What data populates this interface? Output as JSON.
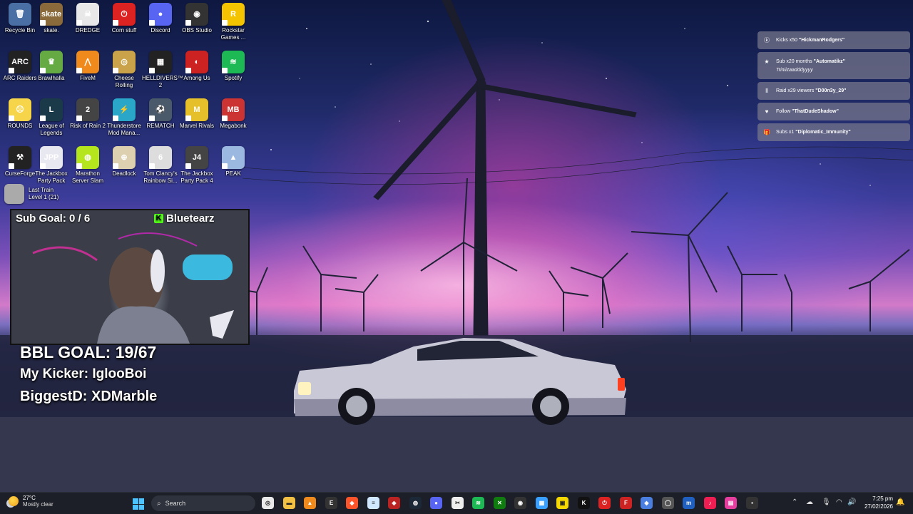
{
  "desktop_icons": [
    {
      "label": "Recycle Bin",
      "color": "#4a6fa5",
      "glyph": "🗑"
    },
    {
      "label": "skate.",
      "color": "#8a6a3a",
      "glyph": "skate"
    },
    {
      "label": "DREDGE",
      "color": "#e8e8e8",
      "glyph": "☠"
    },
    {
      "label": "Corn stuff",
      "color": "#d22",
      "glyph": "⏻"
    },
    {
      "label": "Discord",
      "color": "#5865f2",
      "glyph": "●"
    },
    {
      "label": "OBS Studio",
      "color": "#333",
      "glyph": "◉"
    },
    {
      "label": "Rockstar Games ...",
      "color": "#f5c400",
      "glyph": "R"
    },
    {
      "label": "ARC Raiders",
      "color": "#222",
      "glyph": "ARC"
    },
    {
      "label": "Brawlhalla",
      "color": "#6a4",
      "glyph": "♛"
    },
    {
      "label": "FiveM",
      "color": "#f08a1c",
      "glyph": "⋀"
    },
    {
      "label": "Cheese Rolling",
      "color": "#c9a24a",
      "glyph": "◎"
    },
    {
      "label": "HELLDIVERS™ 2",
      "color": "#222",
      "glyph": "▦"
    },
    {
      "label": "Among Us",
      "color": "#c22",
      "glyph": "◐"
    },
    {
      "label": "Spotify",
      "color": "#1db954",
      "glyph": "≋"
    },
    {
      "label": "ROUNDS",
      "color": "#f6d54a",
      "glyph": "☹"
    },
    {
      "label": "League of Legends",
      "color": "#1a3a4a",
      "glyph": "L"
    },
    {
      "label": "Risk of Rain 2",
      "color": "#444",
      "glyph": "2"
    },
    {
      "label": "Thunderstore Mod Mana...",
      "color": "#2aa6c9",
      "glyph": "⚡"
    },
    {
      "label": "REMATCH",
      "color": "#4a5a6a",
      "glyph": "⚽"
    },
    {
      "label": "Marvel Rivals",
      "color": "#e5c02a",
      "glyph": "M"
    },
    {
      "label": "Megabonk",
      "color": "#c33",
      "glyph": "MB"
    },
    {
      "label": "CurseForge",
      "color": "#222",
      "glyph": "⚒"
    },
    {
      "label": "The Jackbox Party Pack",
      "color": "#e8e8f0",
      "glyph": "JPP"
    },
    {
      "label": "Marathon Server Slam",
      "color": "#b5e61d",
      "glyph": "◍"
    },
    {
      "label": "Deadlock",
      "color": "#ddd0b0",
      "glyph": "⊕"
    },
    {
      "label": "Tom Clancy's Rainbow Si...",
      "color": "#ddd",
      "glyph": "6"
    },
    {
      "label": "The Jackbox Party Pack 4",
      "color": "#444",
      "glyph": "J4"
    },
    {
      "label": "PEAK",
      "color": "#9ab8e0",
      "glyph": "▲"
    },
    {
      "label": "Last Train",
      "color": "#aaa",
      "glyph": ""
    },
    {
      "label": "Level 1 (21)",
      "color": "#aaa",
      "glyph": ""
    }
  ],
  "stream": {
    "sub_goal": "Sub Goal:  0 / 6",
    "kick_logo": "K",
    "channel": "Bluetearz",
    "bbl_goal": "BBL GOAL: 19/67",
    "my_kicker": "My Kicker: IglooBoi",
    "biggest_d": "BiggestD: XDMarble"
  },
  "alerts": [
    {
      "icon": "ⓚ",
      "text": "Kicks x50 ",
      "who": "\"HickmanRodgers\"",
      "msg": ""
    },
    {
      "icon": "★",
      "text": "Sub x20 months ",
      "who": "\"Automatikz\"",
      "msg": "Triniizaadddyyyy"
    },
    {
      "icon": "⦀",
      "text": "Raid x29 viewers ",
      "who": "\"D00n3y_29\"",
      "msg": ""
    },
    {
      "icon": "♥",
      "text": "Follow ",
      "who": "\"ThatDudeShadow\"",
      "msg": ""
    },
    {
      "icon": "🎁",
      "text": "Subs x1 ",
      "who": "\"Diplomatic_Immunity\"",
      "msg": ""
    }
  ],
  "taskbar": {
    "weather_temp": "27°C",
    "weather_cond": "Mostly clear",
    "search_placeholder": "Search",
    "apps": [
      {
        "name": "chrome",
        "color": "#e9e9e9",
        "glyph": "◎"
      },
      {
        "name": "file-explorer",
        "color": "#f2c043",
        "glyph": "▬"
      },
      {
        "name": "vlc",
        "color": "#f08a1c",
        "glyph": "▲"
      },
      {
        "name": "epic-games",
        "color": "#333",
        "glyph": "E"
      },
      {
        "name": "brave",
        "color": "#fb542b",
        "glyph": "◆"
      },
      {
        "name": "notepad",
        "color": "#cfe7ff",
        "glyph": "≡"
      },
      {
        "name": "app-red",
        "color": "#b22",
        "glyph": "◈"
      },
      {
        "name": "steam",
        "color": "#1b2838",
        "glyph": "◍"
      },
      {
        "name": "discord",
        "color": "#5865f2",
        "glyph": "●"
      },
      {
        "name": "capcut",
        "color": "#eee",
        "glyph": "✂"
      },
      {
        "name": "spotify",
        "color": "#1db954",
        "glyph": "≋"
      },
      {
        "name": "xbox",
        "color": "#107c10",
        "glyph": "✕"
      },
      {
        "name": "obs",
        "color": "#333",
        "glyph": "◉"
      },
      {
        "name": "photos",
        "color": "#3aa0ff",
        "glyph": "▦"
      },
      {
        "name": "sticky-notes",
        "color": "#f5d800",
        "glyph": "▣"
      },
      {
        "name": "kick",
        "color": "#111",
        "glyph": "K"
      },
      {
        "name": "corn-stuff",
        "color": "#d22",
        "glyph": "⏻"
      },
      {
        "name": "app-f",
        "color": "#c22",
        "glyph": "F"
      },
      {
        "name": "app-diamond",
        "color": "#4a7fe0",
        "glyph": "◆"
      },
      {
        "name": "app-circle",
        "color": "#555",
        "glyph": "◯"
      },
      {
        "name": "mcbd",
        "color": "#2060c0",
        "glyph": "m"
      },
      {
        "name": "tiktok",
        "color": "#ee1d52",
        "glyph": "♪"
      },
      {
        "name": "app-pink",
        "color": "#e53e9e",
        "glyph": "▤"
      },
      {
        "name": "app-dark",
        "color": "#333",
        "glyph": "▪"
      }
    ],
    "time": "7:25 pm",
    "date": "27/02/2026"
  }
}
